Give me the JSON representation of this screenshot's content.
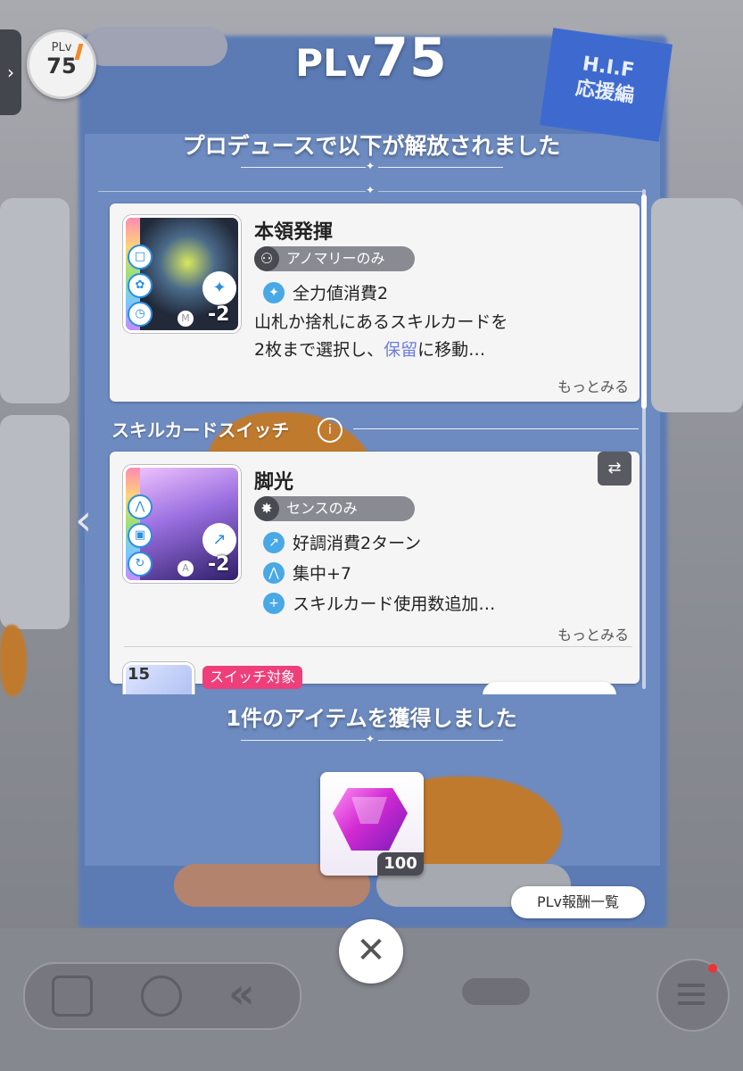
{
  "header": {
    "plv_prefix": "PLv",
    "plv_value": "75",
    "subtitle": "プロデュースで以下が解放されました"
  },
  "badge": {
    "label": "PLv",
    "level": "75"
  },
  "side_tab_icon": "chevron-right-icon",
  "cards": [
    {
      "title": "本領発揮",
      "tag": "アノマリーのみ",
      "tag_icon": "anomaly-icon",
      "effects": [
        {
          "icon": "full-power-icon",
          "text": "全力値消費2"
        }
      ],
      "desc_line1": "山札か捨札にあるスキルカードを",
      "desc_line2_pre": "2枚まで選択し、",
      "desc_line2_hl": "保留",
      "desc_line2_post": "に移動…",
      "cost": "-2",
      "rank": "M",
      "more": "もっとみる"
    },
    {
      "title": "脚光",
      "tag": "センスのみ",
      "tag_icon": "sense-icon",
      "effects": [
        {
          "icon": "good-condition-icon",
          "text": "好調消費2ターン"
        },
        {
          "icon": "concentration-icon",
          "text": "集中+7"
        },
        {
          "icon": "card-use-plus-icon",
          "text": "スキルカード使用数追加…"
        }
      ],
      "cost": "-2",
      "rank": "A",
      "more": "もっとみる"
    }
  ],
  "section": {
    "label": "スキルカードスイッチ",
    "info_icon": "info-icon"
  },
  "partial_card": {
    "level_number": "15",
    "switch_tag": "スイッチ対象"
  },
  "footer": {
    "got_text": "1件のアイテムを獲得しました",
    "item_quantity": "100",
    "reward_list_button": "PLv報酬一覧",
    "close_icon": "close-icon"
  },
  "background": {
    "hif_line1": "H.I.F",
    "hif_line2": "応援編"
  },
  "colors": {
    "accent_blue": "#49a8e6",
    "switch_pink": "#ee3f7a",
    "highlight_purple": "#6f7de0"
  }
}
